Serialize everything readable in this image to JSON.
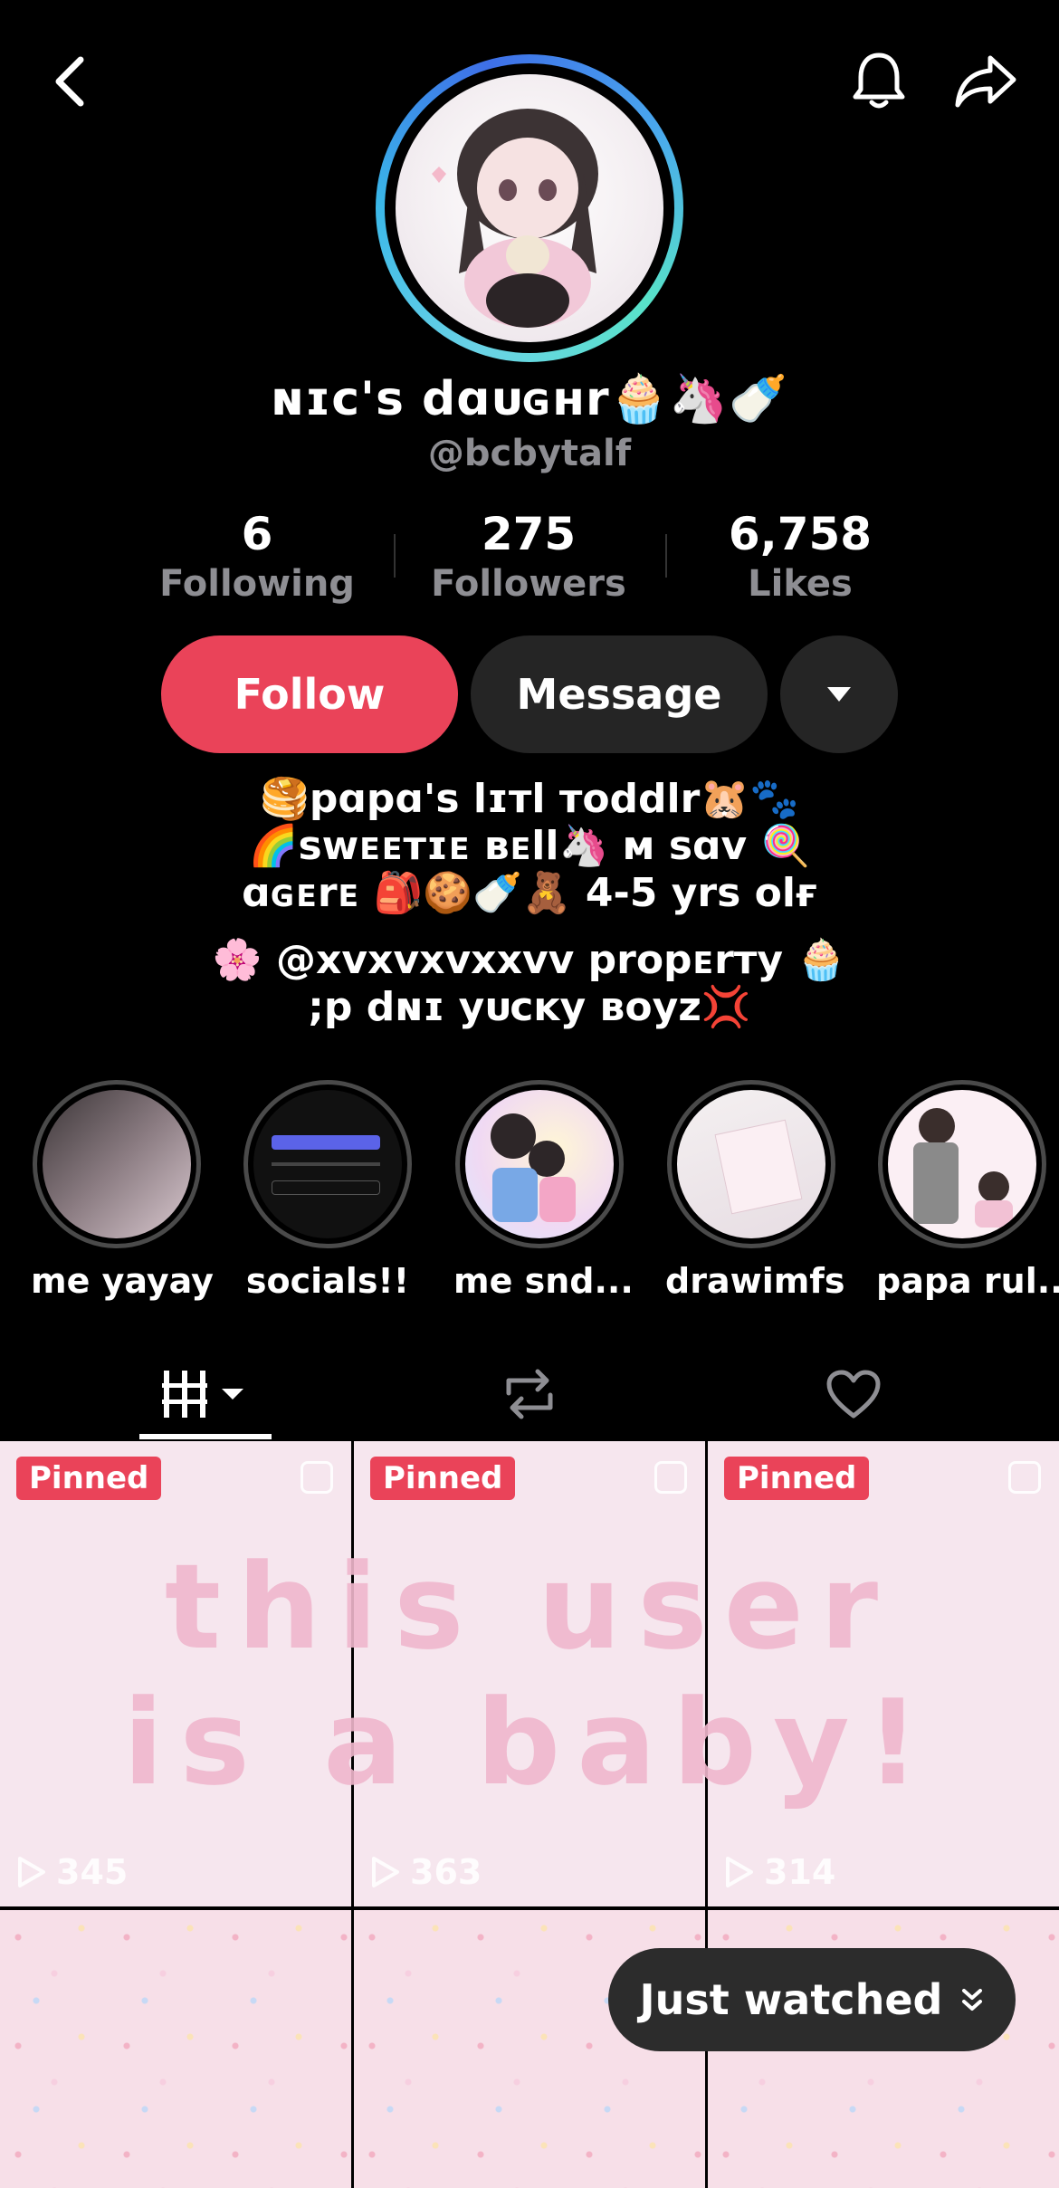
{
  "profile": {
    "display_name": "ɴɪᴄ's dɑᴜɢʜr🧁🦄🍼",
    "handle": "@bcbytalf",
    "stats": {
      "following_count": "6",
      "following_label": "Following",
      "followers_count": "275",
      "followers_label": "Followers",
      "likes_count": "6,758",
      "likes_label": "Likes"
    },
    "bio_lines": [
      "🥞pɑpɑ's lɪтl тoddlr🐹🐾",
      "🌈sᴡᴇᴇтɪᴇ ʙᴇll🦄 ᴍ sɑv 🍭",
      "ɑɢᴇrᴇ 🎒🍪🍼🧸 4-5 yrs olғ"
    ],
    "bio_lines_2": [
      "🌸 @xvxvxvxxvv propᴇrтy 🧁",
      ";p dɴɪ yᴜᴄᴋy ʙoyz💢"
    ]
  },
  "actions": {
    "follow": "Follow",
    "message": "Message"
  },
  "highlights": [
    {
      "label": "me yayay"
    },
    {
      "label": "socials!!"
    },
    {
      "label": "me snd..."
    },
    {
      "label": "drawimfs"
    },
    {
      "label": "papa rul..."
    }
  ],
  "videos": {
    "pinned_label": "Pinned",
    "overlay_text_line1": "this user",
    "overlay_text_line2": "is a baby!",
    "items": [
      {
        "pinned": true,
        "views": "345"
      },
      {
        "pinned": true,
        "views": "363"
      },
      {
        "pinned": true,
        "views": "314"
      },
      {
        "pinned": false,
        "views": ""
      },
      {
        "pinned": false,
        "views": ""
      },
      {
        "pinned": false,
        "views": ""
      }
    ]
  },
  "just_watched": "Just watched",
  "colors": {
    "accent": "#ea4359",
    "secondary_button": "#252525",
    "muted_text": "#8e8e93"
  },
  "icons": [
    "back-icon",
    "bell-icon",
    "share-icon",
    "chevron-down-icon",
    "grid-icon",
    "repost-icon",
    "heart-icon",
    "play-icon"
  ]
}
